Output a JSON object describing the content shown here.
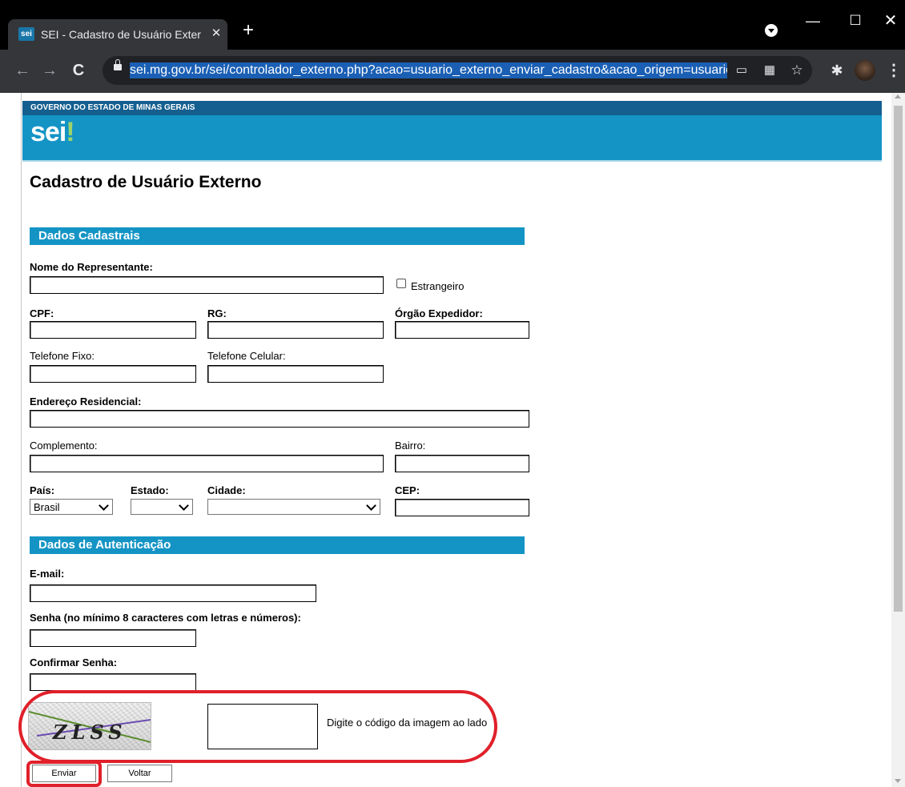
{
  "browser": {
    "tab_favicon": "sei",
    "tab_title": "SEI - Cadastro de Usuário Externo",
    "tab_close": "✕",
    "new_tab": "+",
    "url": "sei.mg.gov.br/sei/controlador_externo.php?acao=usuario_externo_enviar_cadastro&acao_origem=usuario_e",
    "icons": [
      "back-icon",
      "forward-icon",
      "reload-icon",
      "lock-icon",
      "cast-icon",
      "qr-icon",
      "star-icon",
      "extensions-icon",
      "avatar",
      "menu-icon"
    ]
  },
  "header": {
    "gov_label": "GOVERNO DO ESTADO DE MINAS GERAIS",
    "logo_text": "sei",
    "logo_mark": "!",
    "brand_colors": {
      "dark_bar": "#155f90",
      "banner": "#1494c5",
      "logo_accent": "#9ed36a"
    }
  },
  "page": {
    "title": "Cadastro de Usuário Externo"
  },
  "sections": {
    "dados_cadastrais": "Dados Cadastrais",
    "dados_autenticacao": "Dados de Autenticação"
  },
  "form": {
    "nome_representante": {
      "label": "Nome do Representante:",
      "value": ""
    },
    "estrangeiro": {
      "label": "Estrangeiro",
      "checked": false
    },
    "cpf": {
      "label": "CPF:",
      "value": ""
    },
    "rg": {
      "label": "RG:",
      "value": ""
    },
    "orgao_expedidor": {
      "label": "Órgão Expedidor:",
      "value": ""
    },
    "telefone_fixo": {
      "label": "Telefone Fixo:",
      "value": ""
    },
    "telefone_celular": {
      "label": "Telefone Celular:",
      "value": ""
    },
    "endereco_residencial": {
      "label": "Endereço Residencial:",
      "value": ""
    },
    "complemento": {
      "label": "Complemento:",
      "value": ""
    },
    "bairro": {
      "label": "Bairro:",
      "value": ""
    },
    "pais": {
      "label": "País:",
      "value": "Brasil"
    },
    "estado": {
      "label": "Estado:",
      "value": ""
    },
    "cidade": {
      "label": "Cidade:",
      "value": ""
    },
    "cep": {
      "label": "CEP:",
      "value": ""
    },
    "email": {
      "label": "E-mail:",
      "value": ""
    },
    "senha": {
      "label": "Senha (no mínimo 8 caracteres com letras e números):",
      "value": ""
    },
    "confirmar_senha": {
      "label": "Confirmar Senha:",
      "value": ""
    }
  },
  "captcha": {
    "image_text": "ZLSS",
    "hint": "Digite o código da imagem ao lado",
    "highlight_color": "#e0202a"
  },
  "buttons": {
    "enviar": "Enviar",
    "voltar": "Voltar"
  }
}
